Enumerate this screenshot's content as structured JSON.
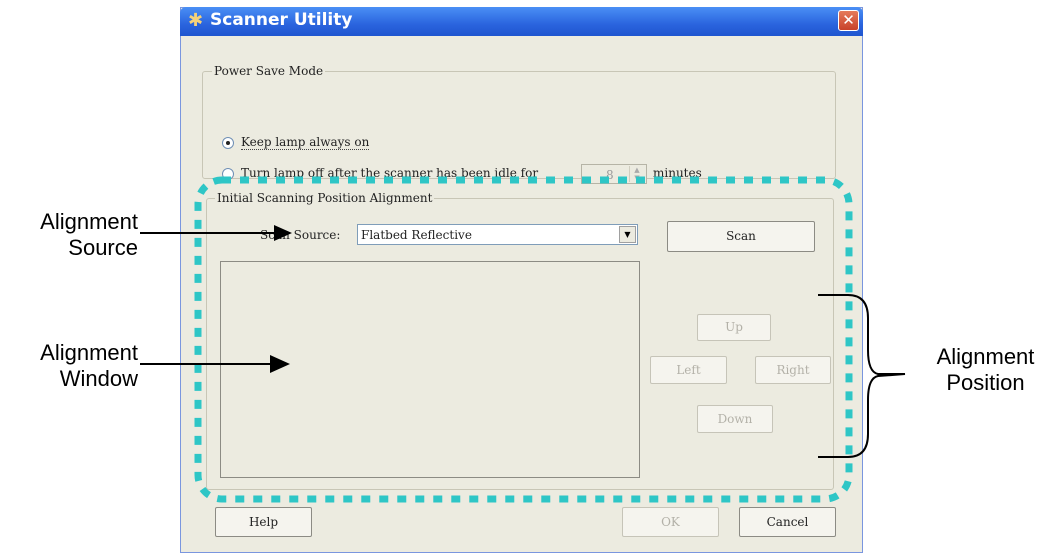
{
  "window": {
    "title": "Scanner Utility",
    "close_glyph": "✕"
  },
  "power_save": {
    "legend": "Power Save Mode",
    "option_always_on": "Keep lamp always on",
    "option_idle": "Turn lamp off after the scanner has been idle for",
    "idle_value": "8",
    "idle_unit": "minutes",
    "selected": "option_always_on"
  },
  "alignment": {
    "legend": "Initial Scanning Position Alignment",
    "scan_source_label": "Scan Source:",
    "scan_source_value": "Flatbed Reflective",
    "scan_button": "Scan",
    "up_button": "Up",
    "left_button": "Left",
    "right_button": "Right",
    "down_button": "Down"
  },
  "footer": {
    "help": "Help",
    "ok": "OK",
    "cancel": "Cancel"
  },
  "annotations": {
    "source_line1": "Alignment",
    "source_line2": "Source",
    "window_line1": "Alignment",
    "window_line2": "Window",
    "position_line1": "Alignment",
    "position_line2": "Position"
  },
  "colors": {
    "highlight": "#2ec6c6",
    "title_bar": "#2a64de",
    "dialog_bg": "#ecebe0"
  },
  "icons": {
    "title": "scanner-app-icon",
    "close": "close-icon"
  }
}
